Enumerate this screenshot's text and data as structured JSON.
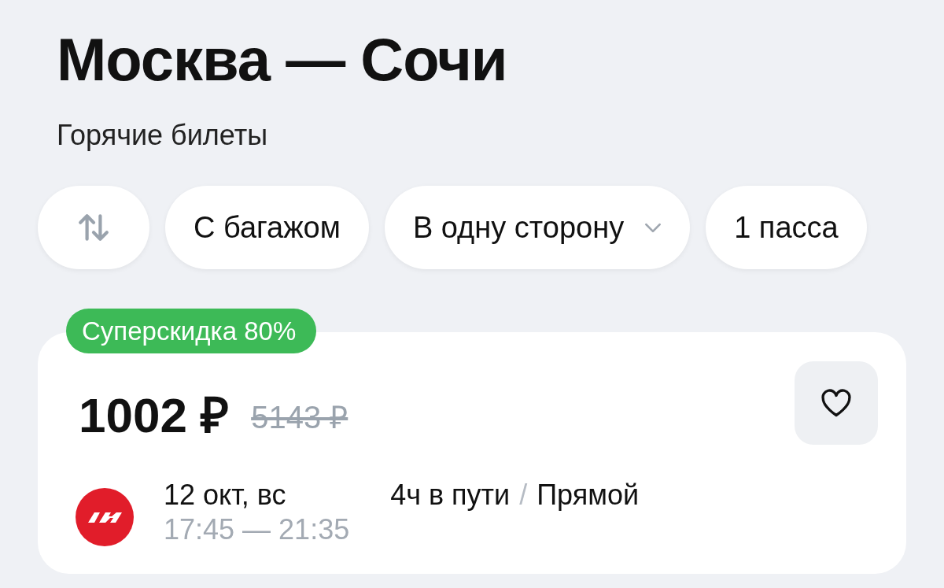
{
  "header": {
    "title": "Москва — Сочи",
    "subtitle": "Горячие билеты"
  },
  "filters": [
    {
      "kind": "swap"
    },
    {
      "kind": "text",
      "label": "С багажом"
    },
    {
      "kind": "dropdown",
      "label": "В одну сторону"
    },
    {
      "kind": "text",
      "label": "1 пасса"
    }
  ],
  "offer": {
    "badge": "Суперскидка 80%",
    "price": "1002 ₽",
    "old_price": "5143 ₽",
    "favorite": false,
    "flight": {
      "date": "12 окт, вс",
      "time": "17:45 — 21:35",
      "duration": "4ч в пути",
      "separator": "/",
      "stops": "Прямой"
    }
  }
}
